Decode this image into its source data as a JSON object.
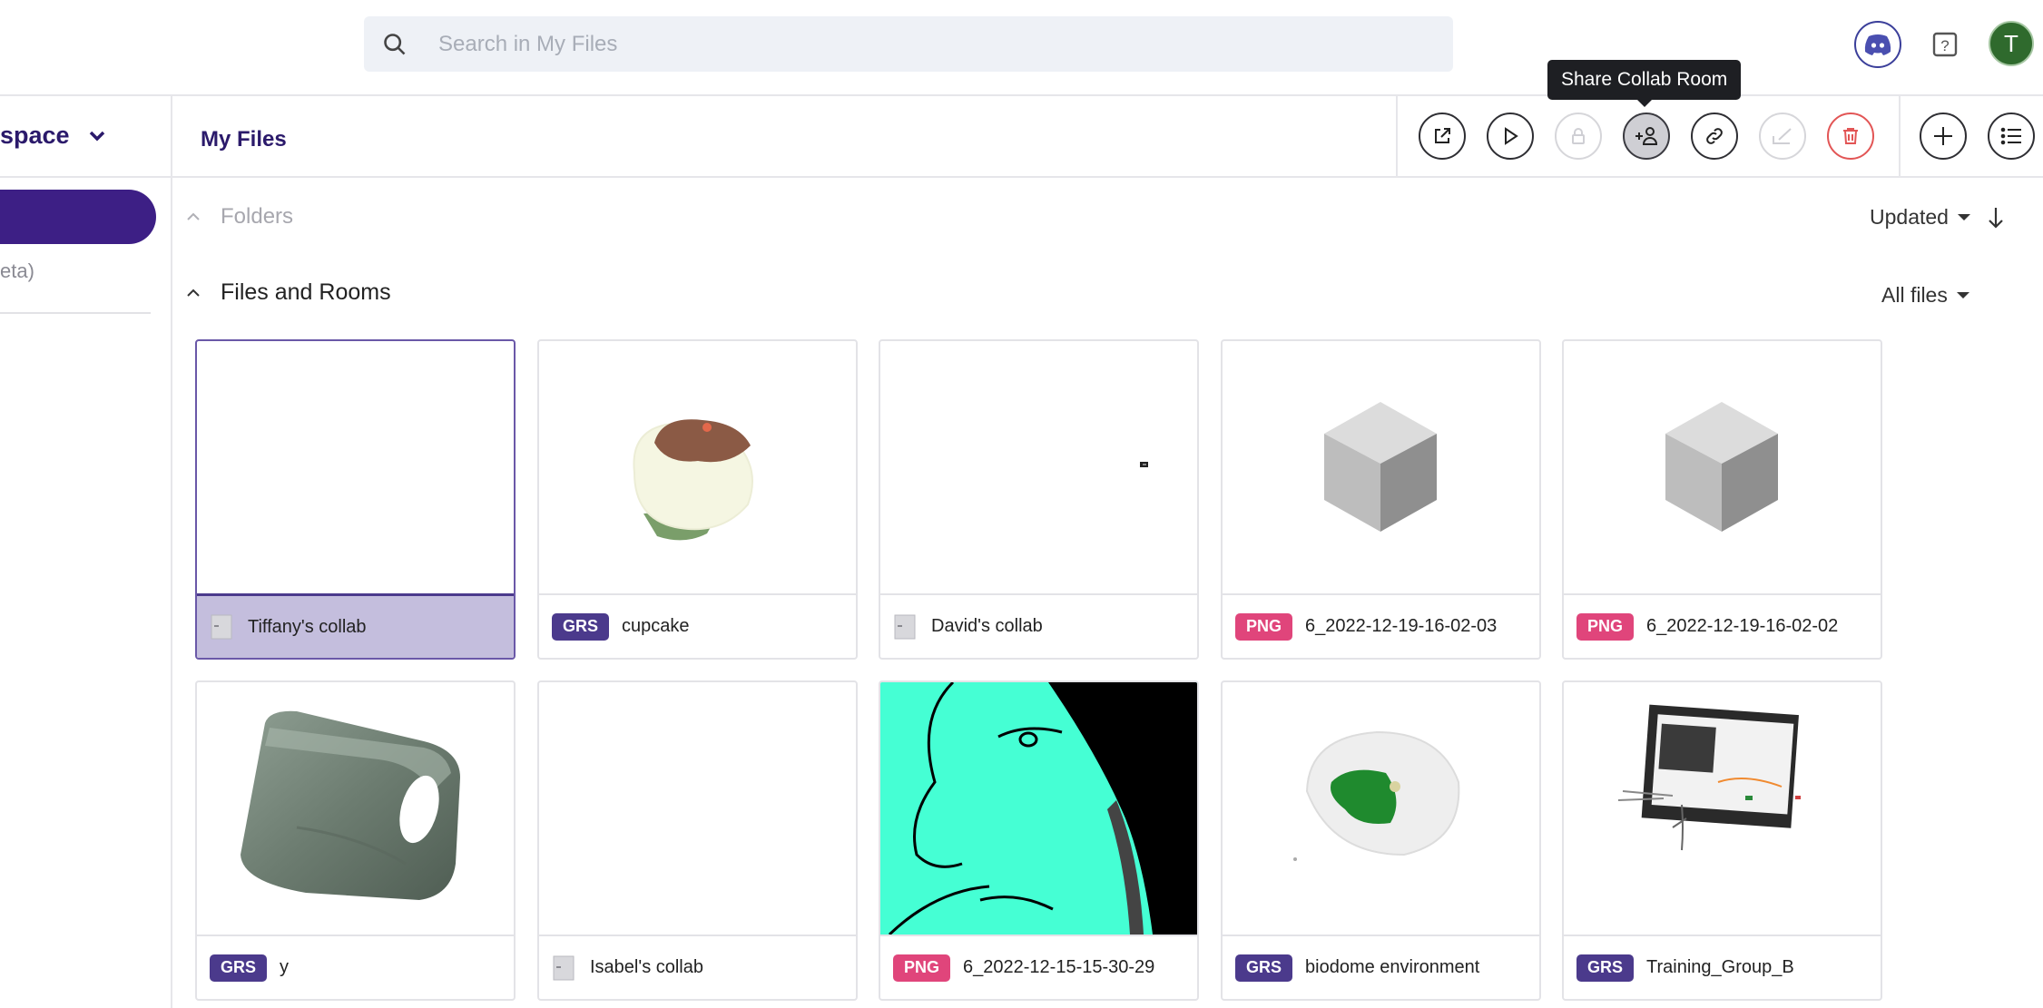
{
  "search": {
    "placeholder": "Search in My Files",
    "icon": "search-icon"
  },
  "header": {
    "avatar_initial": "T",
    "tooltip": "Share Collab Room"
  },
  "sidebar": {
    "workspace_label": "space",
    "beta_label": "eta)"
  },
  "breadcrumb": {
    "current": "My Files"
  },
  "toolbar": {
    "buttons": [
      "open-external",
      "play",
      "lock",
      "share-collab-room",
      "link",
      "sign",
      "delete",
      "add",
      "list-view"
    ]
  },
  "sections": {
    "folders": "Folders",
    "files_and_rooms": "Files and Rooms"
  },
  "sort": {
    "label": "Updated"
  },
  "filter": {
    "label": "All files"
  },
  "colors": {
    "accent": "#3d1f85",
    "grs": "#4b3a8c",
    "png": "#e0457b",
    "teal": "#45ffd4"
  },
  "files": [
    {
      "name": "Tiffany's collab",
      "type": "room"
    },
    {
      "name": "cupcake",
      "type": "GRS"
    },
    {
      "name": "David's collab",
      "type": "room"
    },
    {
      "name": "6_2022-12-19-16-02-03",
      "type": "PNG"
    },
    {
      "name": "6_2022-12-19-16-02-02",
      "type": "PNG"
    },
    {
      "name": "y",
      "type": "GRS"
    },
    {
      "name": "Isabel's collab",
      "type": "room"
    },
    {
      "name": "6_2022-12-15-15-30-29",
      "type": "PNG"
    },
    {
      "name": "biodome environment",
      "type": "GRS"
    },
    {
      "name": "Training_Group_B",
      "type": "GRS"
    }
  ]
}
